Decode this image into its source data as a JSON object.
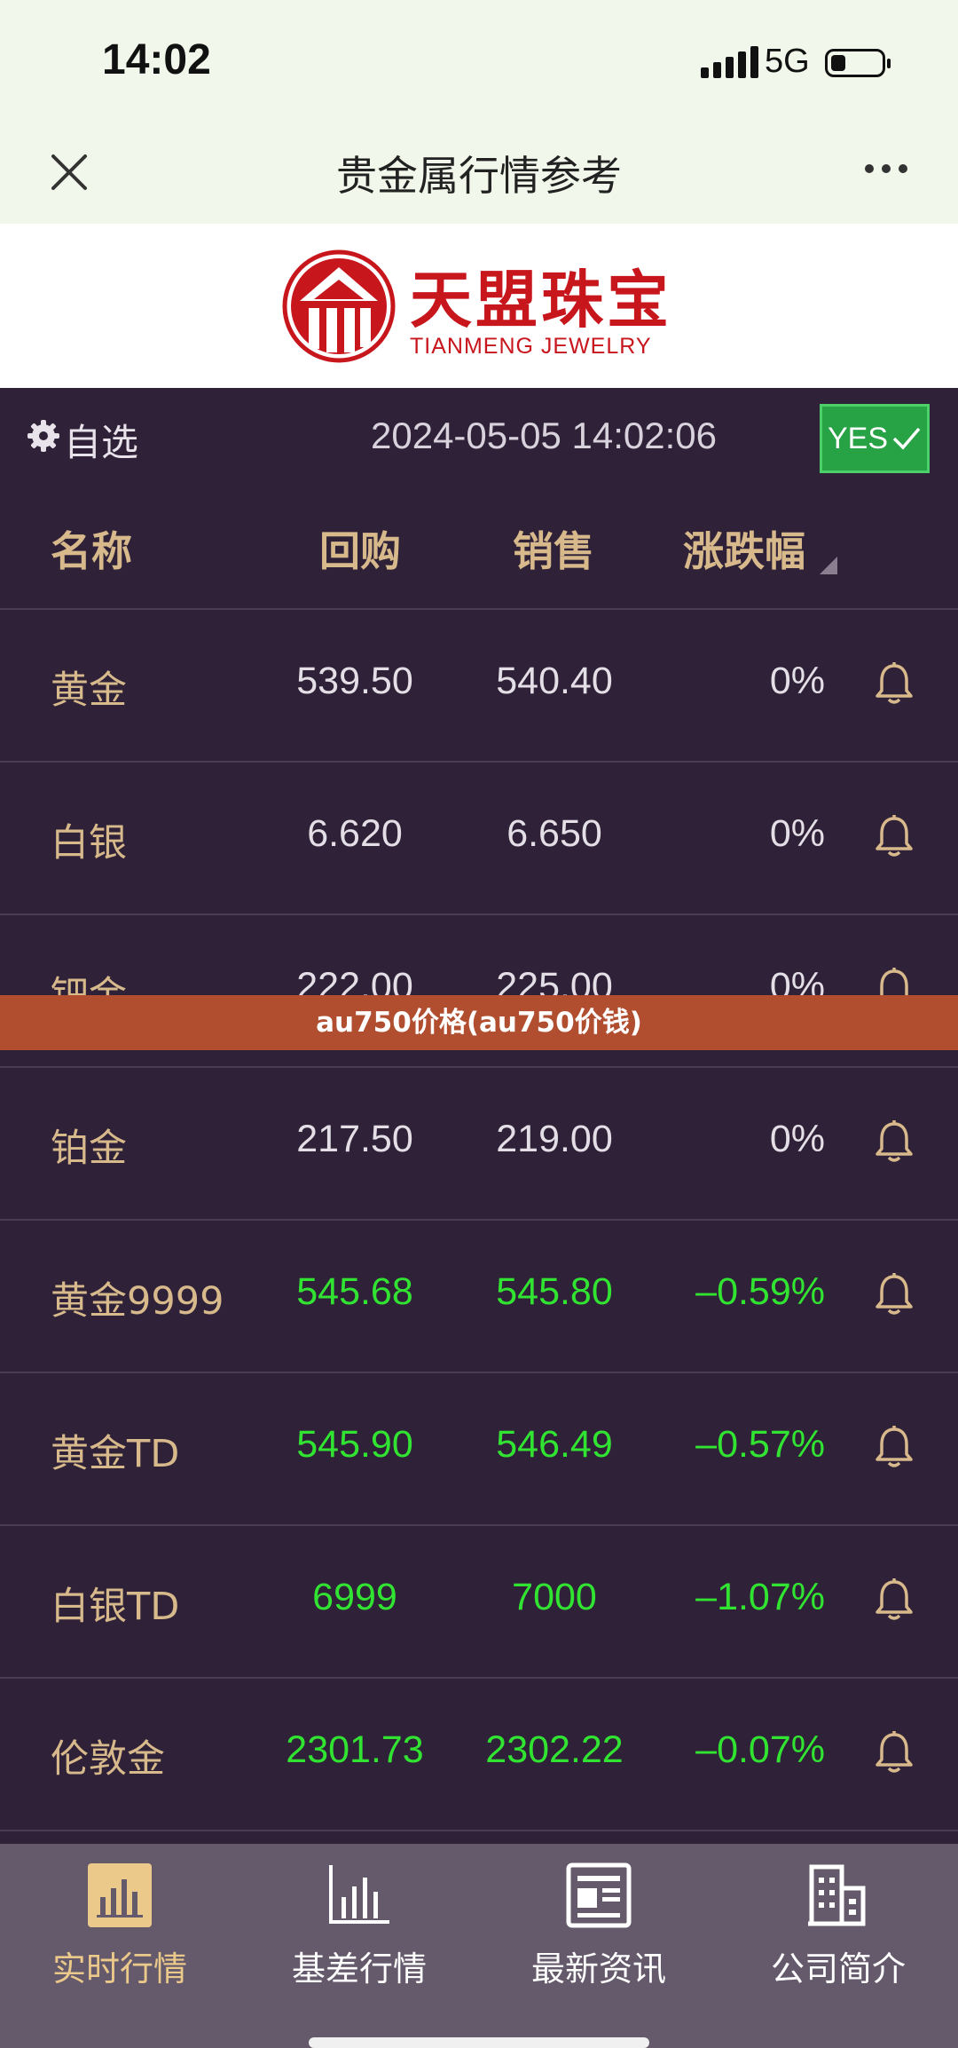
{
  "status_bar": {
    "time": "14:02",
    "network": "5G"
  },
  "nav": {
    "title": "贵金属行情参考"
  },
  "brand": {
    "name_cn": "天盟珠宝",
    "name_en": "TIANMENG JEWELRY"
  },
  "toolbar": {
    "watchlist_label": "自选",
    "datetime": "2024-05-05 14:02:06",
    "yes_label": "YES"
  },
  "table": {
    "headers": {
      "name": "名称",
      "buy": "回购",
      "sell": "销售",
      "change": "涨跌幅"
    },
    "rows": [
      {
        "name": "黄金",
        "buy": "539.50",
        "sell": "540.40",
        "change": "0%",
        "trend": "neutral"
      },
      {
        "name": "白银",
        "buy": "6.620",
        "sell": "6.650",
        "change": "0%",
        "trend": "neutral"
      },
      {
        "name": "钯金",
        "buy": "222.00",
        "sell": "225.00",
        "change": "0%",
        "trend": "neutral"
      },
      {
        "name": "铂金",
        "buy": "217.50",
        "sell": "219.00",
        "change": "0%",
        "trend": "neutral"
      },
      {
        "name": "黄金9999",
        "buy": "545.68",
        "sell": "545.80",
        "change": "–0.59%",
        "trend": "down"
      },
      {
        "name": "黄金TD",
        "buy": "545.90",
        "sell": "546.49",
        "change": "–0.57%",
        "trend": "down"
      },
      {
        "name": "白银TD",
        "buy": "6999",
        "sell": "7000",
        "change": "–1.07%",
        "trend": "down"
      },
      {
        "name": "伦敦金",
        "buy": "2301.73",
        "sell": "2302.22",
        "change": "–0.07%",
        "trend": "down"
      }
    ]
  },
  "banner": {
    "text": "au750价格(au750价钱)"
  },
  "tabs": [
    {
      "label": "实时行情",
      "icon": "bar-chart-filled-icon",
      "active": true
    },
    {
      "label": "基差行情",
      "icon": "bar-chart-outline-icon",
      "active": false
    },
    {
      "label": "最新资讯",
      "icon": "news-icon",
      "active": false
    },
    {
      "label": "公司简介",
      "icon": "building-icon",
      "active": false
    }
  ],
  "colors": {
    "gold": "#d7b98b",
    "down": "#32e432",
    "neutral": "#e4dfe6",
    "banner": "#b04e2f",
    "yes_green": "#27a244",
    "brand_red": "#c8161d"
  }
}
